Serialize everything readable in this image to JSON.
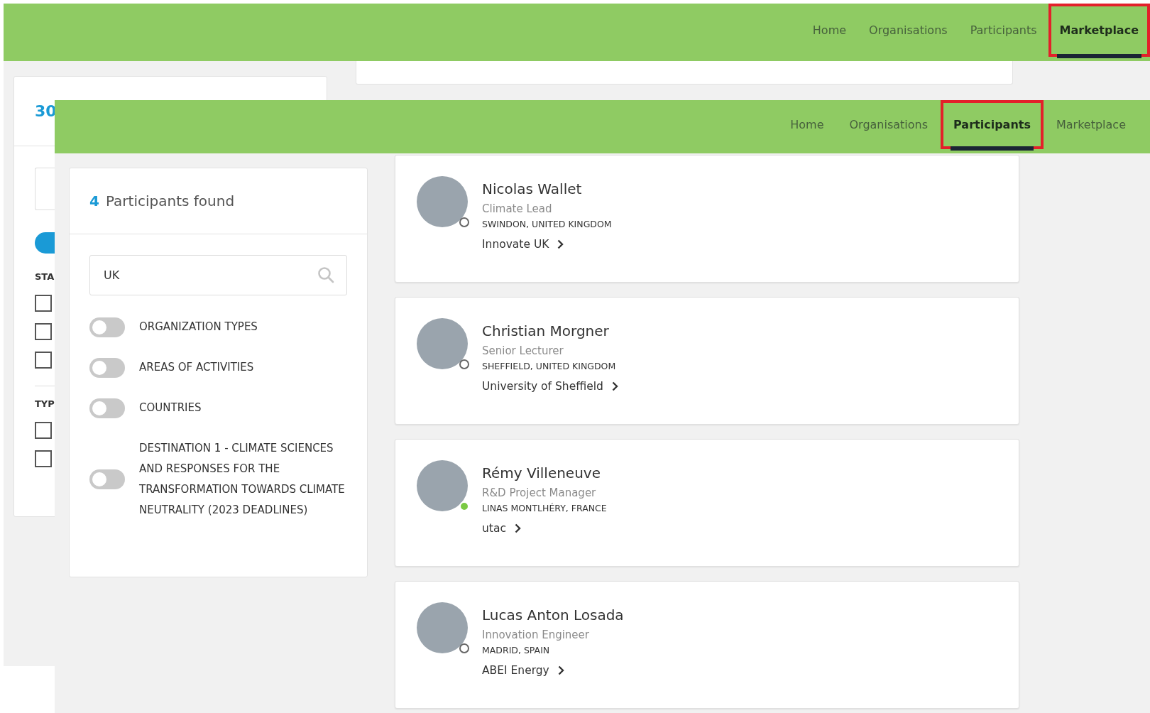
{
  "background_screen": {
    "nav_items": [
      {
        "label": "Home",
        "selected": false,
        "highlighted": false
      },
      {
        "label": "Organisations",
        "selected": false,
        "highlighted": false
      },
      {
        "label": "Participants",
        "selected": false,
        "highlighted": false
      },
      {
        "label": "Marketplace",
        "selected": true,
        "highlighted": true
      }
    ],
    "sidebar": {
      "count": "30",
      "toggle": {
        "on": true
      },
      "groups": [
        {
          "heading": "STA",
          "checkboxes": [
            {
              "checked": false
            },
            {
              "checked": false
            },
            {
              "checked": false
            }
          ]
        },
        {
          "heading": "TYP",
          "checkboxes": [
            {
              "checked": false
            },
            {
              "checked": false
            }
          ]
        }
      ]
    }
  },
  "foreground_screen": {
    "nav_items": [
      {
        "label": "Home",
        "selected": false,
        "highlighted": false
      },
      {
        "label": "Organisations",
        "selected": false,
        "highlighted": false
      },
      {
        "label": "Participants",
        "selected": true,
        "highlighted": true
      },
      {
        "label": "Marketplace",
        "selected": false,
        "highlighted": false
      }
    ],
    "results": {
      "count": "4",
      "label": "Participants found"
    },
    "search": {
      "value": "UK"
    },
    "filters": [
      {
        "label": "ORGANIZATION TYPES",
        "on": false
      },
      {
        "label": "AREAS OF ACTIVITIES",
        "on": false
      },
      {
        "label": "COUNTRIES",
        "on": false
      },
      {
        "label": "DESTINATION 1 - CLIMATE SCIENCES AND RESPONSES FOR THE TRANSFORMATION TOWARDS CLIMATE NEUTRALITY (2023 DEADLINES)",
        "on": false
      }
    ],
    "participants": [
      {
        "name": "Nicolas Wallet",
        "title": "Climate Lead",
        "location": "SWINDON, UNITED KINGDOM",
        "organisation": "Innovate UK",
        "online": false
      },
      {
        "name": "Christian Morgner",
        "title": "Senior Lecturer",
        "location": "SHEFFIELD, UNITED KINGDOM",
        "organisation": "University of Sheffield",
        "online": false
      },
      {
        "name": "Rémy Villeneuve",
        "title": "R&D Project Manager",
        "location": "LINAS MONTLHÉRY, FRANCE",
        "organisation": "utac",
        "online": true
      },
      {
        "name": "Lucas Anton Losada",
        "title": "Innovation Engineer",
        "location": "MADRID, SPAIN",
        "organisation": "ABEI Energy",
        "online": false
      }
    ]
  }
}
